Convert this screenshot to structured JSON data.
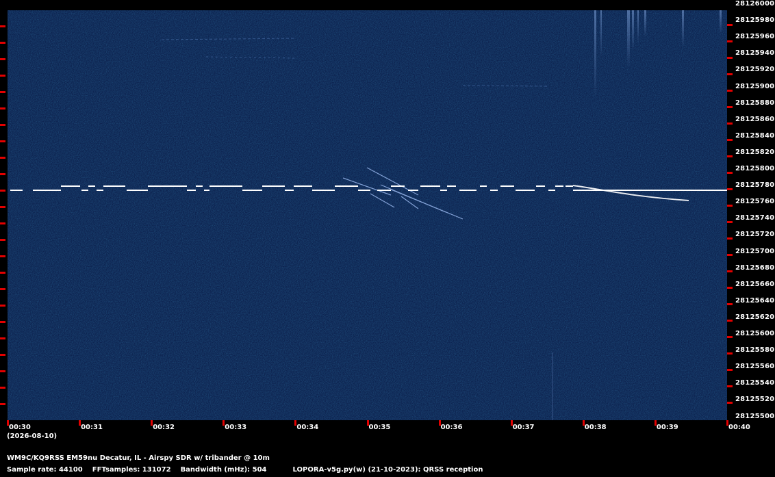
{
  "spectrogram": {
    "background_color": "#0d2350",
    "signal_color": "#ffffff",
    "tick_color": "#e30000",
    "frequency_labels": [
      "28126000",
      "28125980",
      "28125960",
      "28125940",
      "28125920",
      "28125900",
      "28125880",
      "28125860",
      "28125840",
      "28125820",
      "28125800",
      "28125780",
      "28125760",
      "28125740",
      "28125720",
      "28125700",
      "28125680",
      "28125660",
      "28125640",
      "28125620",
      "28125600",
      "28125580",
      "28125560",
      "28125540",
      "28125520",
      "28125500"
    ],
    "time_labels": [
      "00:30",
      "00:31",
      "00:32",
      "00:33",
      "00:34",
      "00:35",
      "00:36",
      "00:37",
      "00:38",
      "00:39",
      "00:40"
    ]
  },
  "footer": {
    "date": "(2026-08-10)",
    "station": "WM9C/KQ9RSS EM59nu Decatur, IL - Airspy SDR w/ tribander @ 10m",
    "sample_rate": "Sample rate: 44100",
    "fft_samples": "FFTsamples: 131072",
    "bandwidth": "Bandwidth (mHz): 504",
    "program": "LOPORA-v5g.py(w) (21-10-2023): QRSS reception"
  }
}
